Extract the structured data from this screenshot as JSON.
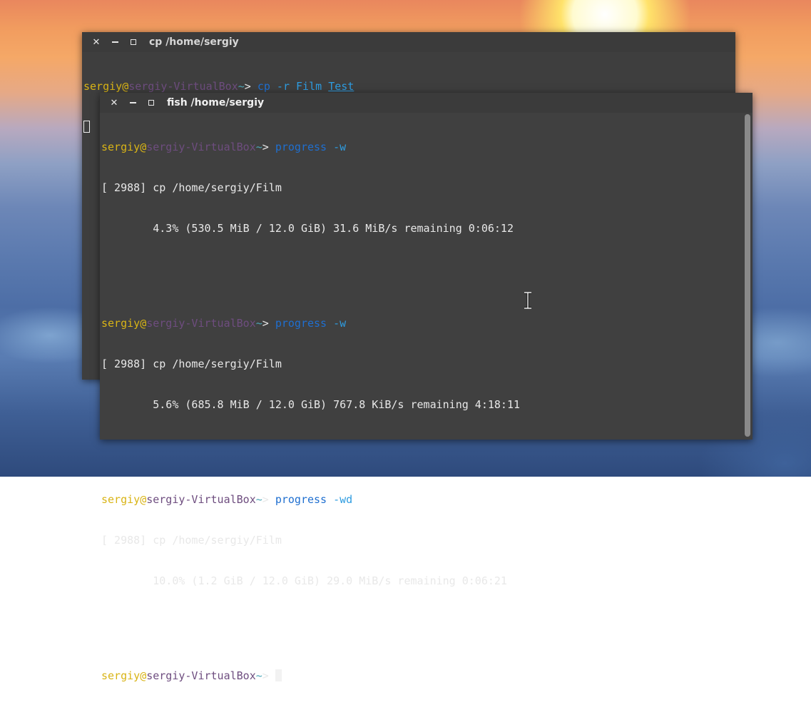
{
  "back_window": {
    "title": "cp  /home/sergiy",
    "prompt": {
      "user": "sergiy",
      "at": "@",
      "host": "sergiy-VirtualBox",
      "tilde": "~",
      "gt": "> "
    },
    "command": {
      "cmd": "cp",
      "args": " -r Film ",
      "dest": "Test"
    }
  },
  "front_window": {
    "title": "fish  /home/sergiy",
    "prompt": {
      "user": "sergiy",
      "at": "@",
      "host": "sergiy-VirtualBox",
      "tilde": "~",
      "gt": "> "
    },
    "blocks": [
      {
        "cmd": "progress",
        "args": " -w",
        "line1": "[ 2988] cp /home/sergiy/Film",
        "line2": "        4.3% (530.5 MiB / 12.0 GiB) 31.6 MiB/s remaining 0:06:12"
      },
      {
        "cmd": "progress",
        "args": " -w",
        "line1": "[ 2988] cp /home/sergiy/Film",
        "line2": "        5.6% (685.8 MiB / 12.0 GiB) 767.8 KiB/s remaining 4:18:11"
      },
      {
        "cmd": "progress",
        "args": " -wd",
        "line1": "[ 2988] cp /home/sergiy/Film",
        "line2": "        10.0% (1.2 GiB / 12.0 GiB) 29.0 MiB/s remaining 0:06:21"
      }
    ]
  },
  "icons": {
    "close": "close-icon",
    "minimize": "minimize-icon",
    "maximize": "maximize-icon",
    "cursor": "text-ibeam-icon"
  },
  "colors": {
    "prompt_user": "#d9b416",
    "prompt_host": "#6e4d7f",
    "prompt_tilde": "#4ba6b8",
    "command": "#1f6fd0",
    "argument": "#2e9ce0",
    "terminal_bg": "#3e3e3e"
  }
}
